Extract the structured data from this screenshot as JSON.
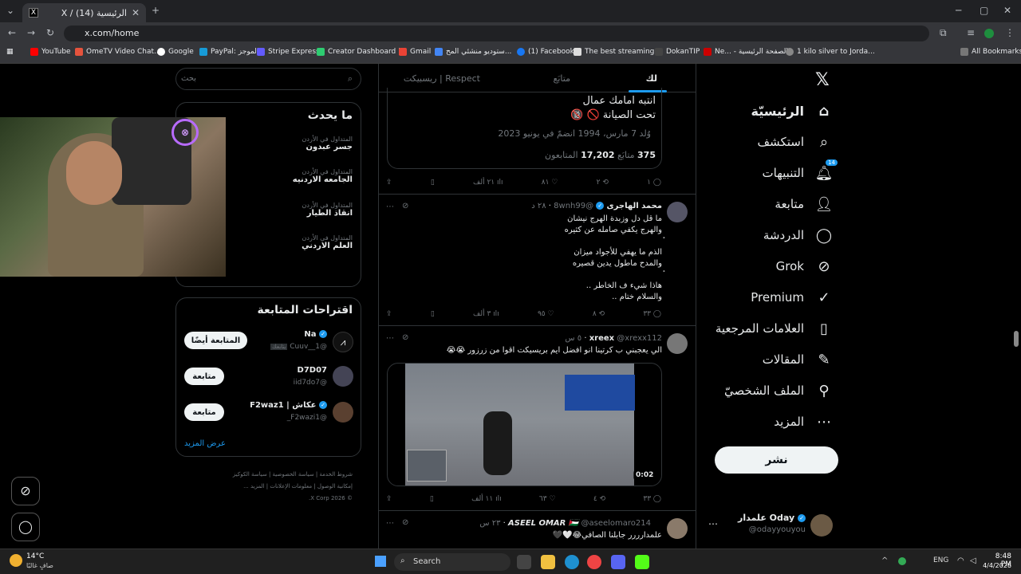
{
  "browser": {
    "tab_title": "X / الرئيسية (14)",
    "url": "x.com/home",
    "all_bookmarks": "All Bookmarks",
    "bookmarks": [
      "YouTube",
      "OmeTV Video Chat...",
      "Google",
      "PayPal: الموجز",
      "Stripe Express",
      "Creator Dashboard |...",
      "Gmail",
      "ستوديو منشئي المح...",
      "(1) Facebook",
      "The best streaming...",
      "DokanTIP",
      "Ne... - الصفحة الرئيسية",
      "1 kilo silver to Jorda..."
    ]
  },
  "nav": {
    "items": [
      {
        "label": "الرئيسيّة",
        "icon": "home-icon"
      },
      {
        "label": "استكشف",
        "icon": "search-icon"
      },
      {
        "label": "التنبيهات",
        "icon": "bell-icon",
        "badge": "14"
      },
      {
        "label": "متابعة",
        "icon": "follow-icon"
      },
      {
        "label": "الدردشة",
        "icon": "chat-icon"
      },
      {
        "label": "Grok",
        "icon": "grok-icon"
      },
      {
        "label": "Premium",
        "icon": "premium-icon"
      },
      {
        "label": "العلامات المرجعية",
        "icon": "bookmark-icon"
      },
      {
        "label": "المقالات",
        "icon": "articles-icon"
      },
      {
        "label": "الملف الشخصيّ",
        "icon": "profile-icon"
      },
      {
        "label": "المزيد",
        "icon": "more-icon"
      }
    ],
    "post": "نشر",
    "account": {
      "name": "Oday علمدار",
      "handle": "@odayyouyou"
    }
  },
  "feed": {
    "tabs": [
      "لك",
      "متابَع",
      "ريسبيكت | Respect"
    ],
    "profile_card": {
      "line1": "انتبه امامك عمال",
      "line2": "تحت الصيانة 🚫 🔞",
      "born": "وُلد 7 مارس، 1994",
      "joined": "انضمّ في يونيو 2023",
      "following_count": "375",
      "following_label": "متابَع",
      "followers_count": "17,202",
      "followers_label": "المتابعون",
      "stats": {
        "replies": "١",
        "reposts": "٢",
        "likes": "٨١",
        "views": "٢١ ألف"
      }
    },
    "tweets": [
      {
        "name": "محمد الهاجرى",
        "handle": "@8wnh99",
        "time": "٢٨ د",
        "lines": [
          "ما قل دل وزبدة الهرج نيشان",
          "والهرج يكفي صامله عن كثيره",
          "ٔ",
          "الذم ما يهفي للأجواد ميزان",
          "والمدح ماطول يدين قصيره",
          "ٔ",
          "هاذا شيء ف الخاطر ..",
          "والسلام ختام .."
        ],
        "replies": "٣٣",
        "reposts": "٨",
        "likes": "٩٥",
        "views": "٣ ألف"
      },
      {
        "name": "xreex",
        "handle": "@xrexx112",
        "time": "٥ س",
        "text": "الي يعجبني ب كرتينا انو افضل ايم بريسيكت اقوا من زرزور 😭😭",
        "video_time": "0:02",
        "replies": "٣٣",
        "reposts": "٤",
        "likes": "٦٣",
        "views": "١١ ألف"
      },
      {
        "name": "ASEEL OMAR 🇵🇸",
        "handle": "@aseelomaro214",
        "time": "٢٣ س",
        "text": "علمدارررر جابلنا الصافي😂🤍🖤"
      }
    ]
  },
  "sidebar": {
    "search_placeholder": "بحث",
    "trends_title": "ما يحدث",
    "trends": [
      {
        "meta": "المتداول في الأردن",
        "name": "جسر عبدون"
      },
      {
        "meta": "المتداول في الأردن",
        "name": "الجامعه الاردنيه"
      },
      {
        "meta": "المتداول في الأردن",
        "name": "انقاذ الطيار"
      },
      {
        "meta": "المتداول في الأردن",
        "name": "العلم الاردني"
      }
    ],
    "follow_title": "اقتراحات المتابعة",
    "follow": [
      {
        "name": "Na",
        "handle": "@Cuuv__1",
        "tag": "يتابعك",
        "button": "المتابعة أيضًا"
      },
      {
        "name": "D7D07",
        "handle": "@iid7do7",
        "button": "متابعة"
      },
      {
        "name": "عكاش | F2waz1",
        "handle": "@F2wazi1_",
        "button": "متابعة"
      }
    ],
    "show_more": "عرض المزيد",
    "footer": [
      "شروط الخدمة",
      "سياسة الخصوصية",
      "سياسة الكوكيز",
      "إمكانية الوصول",
      "معلومات الإعلانات",
      "المزيد ...",
      "© 2026 X Corp."
    ]
  },
  "taskbar": {
    "weather_temp": "14°C",
    "weather_desc": "صافٍ غالبًا",
    "search": "Search",
    "lang": "ENG",
    "time": "8:48 PM",
    "date": "4/4/2026"
  },
  "colors": {
    "accent": "#1d9bf0",
    "bg": "#000000",
    "border": "#2f3336"
  }
}
